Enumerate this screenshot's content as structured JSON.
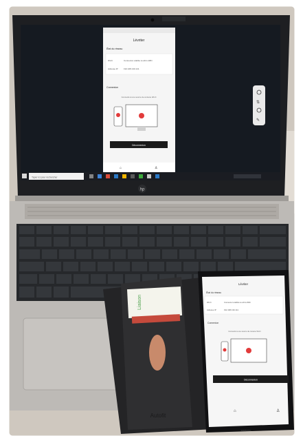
{
  "photo": {
    "description_keys": "laptop-with-mirrored-phone-screen",
    "laptop_brand_logo": "hp",
    "phone_brand_logo": "SAMSUNG"
  },
  "mirrored_screen": {
    "app_title": "Lévriter",
    "section_status": "État du réseau",
    "wifi_label": "Wi-Fi",
    "wifi_value": "Connexion établie à ucbrs-WiFi",
    "address_label": "Adresse IP",
    "address_value": "192.168.130.141",
    "connection_section": "Connexion",
    "connect_hint": "Connecté à une source de contenu Wi-Fi",
    "disconnect_button": "Déconnexion"
  },
  "phone_screen": {
    "app_title": "Lévriter",
    "section_status": "État du réseau",
    "wifi_label": "Wi-Fi",
    "wifi_value": "Connexion établie à ucbrs-WiFi",
    "address_label": "Adresse IP",
    "address_value": "192.168.130.141",
    "connection_section": "Connexion",
    "connect_hint": "Connecté à une source de contenu Wi-Fi",
    "disconnect_button": "Déconnexion"
  },
  "taskbar": {
    "search_placeholder": "Taper ici pour rechercher"
  },
  "wallet": {
    "card_text": "Liaison",
    "brand": "Autofit"
  },
  "colors": {
    "desk": "#c9c1b6",
    "laptop": "#b7b4b0",
    "keyboard": "#26282b",
    "screen_bg": "#151a21",
    "wallet": "#2a2a2c"
  }
}
